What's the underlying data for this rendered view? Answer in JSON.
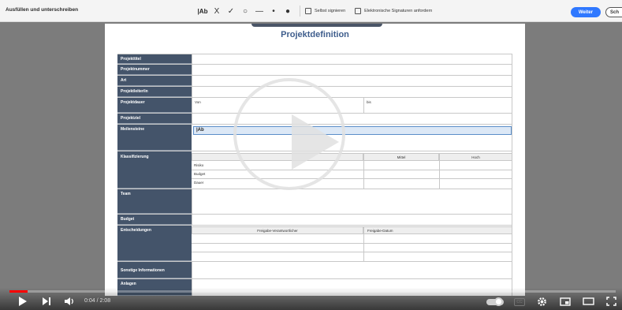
{
  "toolbar": {
    "title": "Ausfüllen und unterschreiben",
    "tools": [
      "|Ab",
      "X",
      "✓",
      "○",
      "—",
      "•",
      "●"
    ],
    "sign_self": "Selbst signieren",
    "request_sig": "Elektronische Signaturen anfordern",
    "weiter": "Weiter",
    "sch": "Sch"
  },
  "document": {
    "title": "Projektdefinition",
    "labels": {
      "projekttitel": "Projekttitel",
      "projektnummer": "Projektnummer",
      "art": "Art",
      "projektleiter": "Projektleiter/in",
      "projektdauer": "Projektdauer",
      "projektziel": "Projektziel",
      "meilensteine": "Meilensteine",
      "klassifizierung": "Klassifizierung",
      "team": "Team",
      "budget": "Budget",
      "entscheidungen": "Entscheidungen",
      "sonstige": "Sonstige Informationen",
      "anlagen": "Anlagen"
    },
    "von": "Von",
    "bis": "bis",
    "meilenstein_value": "|Ab",
    "klass_headers": [
      "",
      "Mittel",
      "Hoch"
    ],
    "klass_rows": [
      "Risiko",
      "Budget",
      "Dauer"
    ],
    "entscheidung_headers": [
      "Freigabe-Verantwortlicher",
      "Freigabe-Datum"
    ]
  },
  "player": {
    "time": "0:04 / 2:08",
    "progress": 0.03
  }
}
